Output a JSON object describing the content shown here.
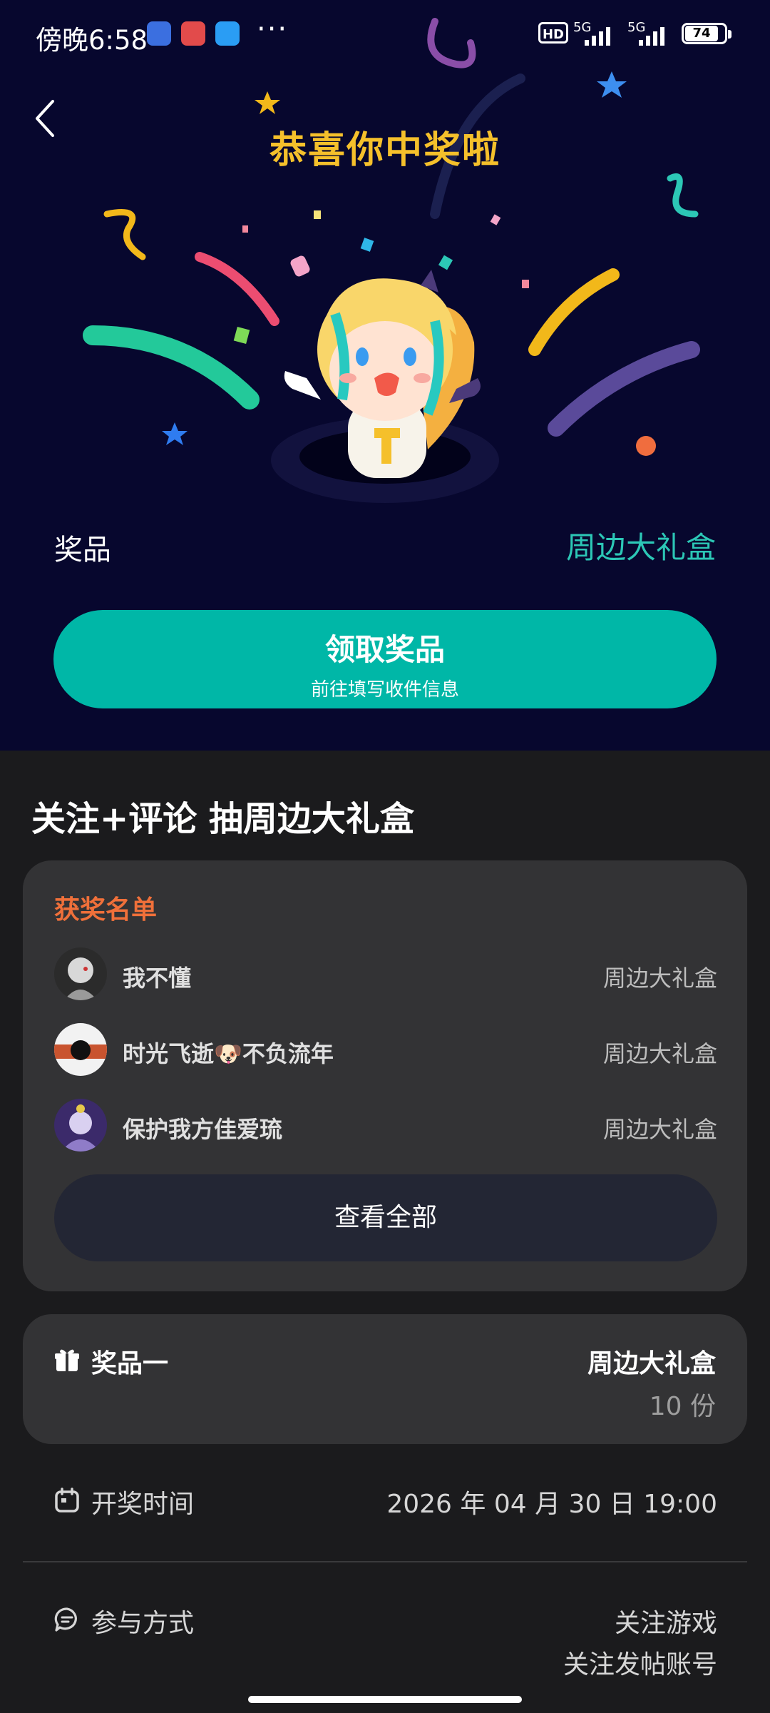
{
  "status_bar": {
    "time": "傍晚6:58",
    "more": "···",
    "hd": "HD",
    "net1": "5G",
    "net2": "5G",
    "battery": "74"
  },
  "hero": {
    "title": "恭喜你中奖啦",
    "prize_label": "奖品",
    "prize_value": "周边大礼盒",
    "claim_button": "领取奖品",
    "claim_sub": "前往填写收件信息"
  },
  "event": {
    "title": "关注+评论 抽周边大礼盒"
  },
  "winners": {
    "heading": "获奖名单",
    "list": [
      {
        "name": "我不懂",
        "prize": "周边大礼盒"
      },
      {
        "name": "时光飞逝🐶不负流年",
        "prize": "周边大礼盒"
      },
      {
        "name": "保护我方佳爱琉",
        "prize": "周边大礼盒"
      }
    ],
    "view_all": "查看全部"
  },
  "prize_card": {
    "label": "奖品一",
    "value": "周边大礼盒",
    "count": "10 份"
  },
  "draw_time": {
    "label": "开奖时间",
    "value": "2026 年 04 月 30 日 19:00"
  },
  "participation": {
    "label": "参与方式",
    "value1": "关注游戏",
    "value2": "关注发帖账号"
  },
  "colors": {
    "hero_bg": "#07072e",
    "title_gold": "#f5c02b",
    "accent_teal": "#00b7a7",
    "winners_heading": "#f0703a"
  }
}
